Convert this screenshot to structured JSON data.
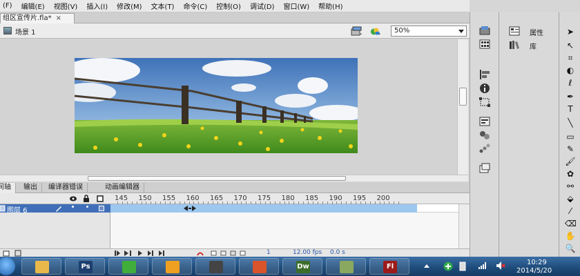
{
  "menu": [
    "(F)",
    "编辑(E)",
    "视图(V)",
    "插入(I)",
    "修改(M)",
    "文本(T)",
    "命令(C)",
    "控制(O)",
    "调试(D)",
    "窗口(W)",
    "帮助(H)"
  ],
  "document_tab": {
    "title": "组区宣传片.fla*",
    "close": "×"
  },
  "scene": {
    "label": "场景 1",
    "zoom": "50%"
  },
  "timeline_tabs": [
    "时间轴",
    "输出",
    "编译器错误",
    "动画编辑器"
  ],
  "timeline_frames": [
    "145",
    "150",
    "155",
    "160",
    "165",
    "170",
    "175",
    "180",
    "185",
    "190",
    "195",
    "200"
  ],
  "layer": {
    "name": "图层 6"
  },
  "timeline_status": {
    "frame": "1",
    "fps": "12.00 fps",
    "time": "0.0 s"
  },
  "panels": {
    "properties": "属性",
    "library": "库"
  },
  "tools": [
    "tool-selection",
    "tool-subselection",
    "tool-free-transform",
    "tool-3d-rotation",
    "tool-lasso",
    "tool-pen",
    "tool-text",
    "tool-line",
    "tool-rectangle",
    "tool-pencil",
    "tool-brush",
    "tool-deco",
    "tool-bone",
    "tool-paint-bucket",
    "tool-eyedropper",
    "tool-eraser",
    "tool-hand",
    "tool-zoom"
  ],
  "taskbar": {
    "apps": [
      {
        "name": "explorer",
        "label": "",
        "color": "#e8b94a"
      },
      {
        "name": "photoshop",
        "label": "Ps",
        "color": "#1c3f6e"
      },
      {
        "name": "browser",
        "label": "",
        "color": "#3fae3a"
      },
      {
        "name": "media",
        "label": "",
        "color": "#f0a020"
      },
      {
        "name": "camera",
        "label": "",
        "color": "#444444"
      },
      {
        "name": "presentation",
        "label": "",
        "color": "#d9542a"
      },
      {
        "name": "dreamweaver",
        "label": "Dw",
        "color": "#3b6e2a"
      },
      {
        "name": "project",
        "label": "",
        "color": "#8aa860"
      },
      {
        "name": "flash",
        "label": "Fl",
        "color": "#9c1a1a"
      }
    ],
    "clock_time": "10:29",
    "clock_date": "2014/5/20"
  }
}
